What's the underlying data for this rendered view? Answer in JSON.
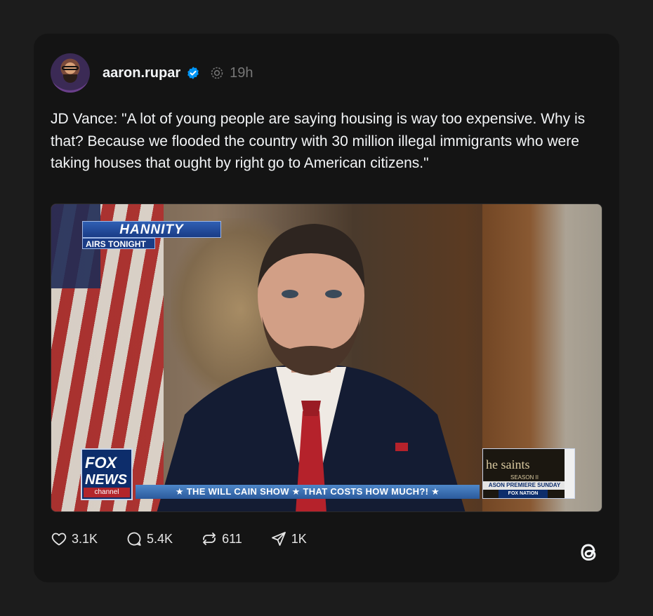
{
  "post": {
    "username": "aaron.rupar",
    "time": "19h",
    "text": "JD Vance: \"A lot of young people are saying housing is way too expensive. Why is that? Because we flooded the country with 30 million illegal immigrants who were taking houses that ought by right go to American citizens.\""
  },
  "media": {
    "hannity": "HANNITY",
    "airs": "AIRS TONIGHT",
    "fox": "FOX",
    "news": "NEWS",
    "channel": "channel",
    "ticker": "★ THE WILL CAIN SHOW ★ THAT COSTS HOW MUCH?! ★",
    "promo_title": "he saints",
    "promo_season": "SEASON II",
    "promo_premiere": "ASON PREMIERE SUNDAY",
    "promo_nation": "FOX NATION"
  },
  "actions": {
    "likes": "3.1K",
    "replies": "5.4K",
    "reposts": "611",
    "shares": "1K"
  },
  "colors": {
    "background": "#1c1c1c",
    "card": "#141414",
    "verified": "#0095f6"
  }
}
